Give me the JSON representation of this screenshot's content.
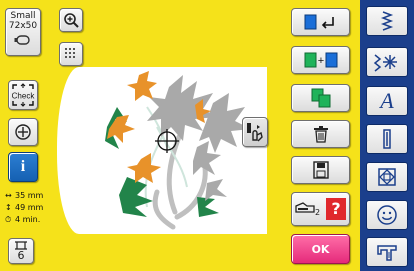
{
  "hoop": {
    "name": "Small",
    "size": "72x50"
  },
  "status": {
    "width": "35 mm",
    "height": "49 mm",
    "time": "4 min."
  },
  "check_label": "Check",
  "info_label": "i",
  "color_count": "6",
  "help_symbol": "?",
  "page_number": "2",
  "ok_label": "OK",
  "mode_strip": {
    "text_mode_label": "A"
  },
  "colors": {
    "screen_bg": "#f5e21a",
    "accent_blue": "#1b3f8c",
    "ok_pink": "#e52a7b",
    "help_red": "#e0282c",
    "thread_orange": "#e8922a",
    "thread_gray": "#a9a9a9",
    "thread_green": "#22844a",
    "thread_light": "#cfe5dc"
  },
  "icons": {
    "zoom": "zoom-in-icon",
    "grid": "grid-icon",
    "hoop": "hoop-icon",
    "center": "crosshair-icon",
    "rotate": "rotate-icon",
    "duplicate": "duplicate-icon",
    "group": "group-icon",
    "delete": "trash-icon",
    "save": "save-icon",
    "manual": "manual-icon"
  }
}
